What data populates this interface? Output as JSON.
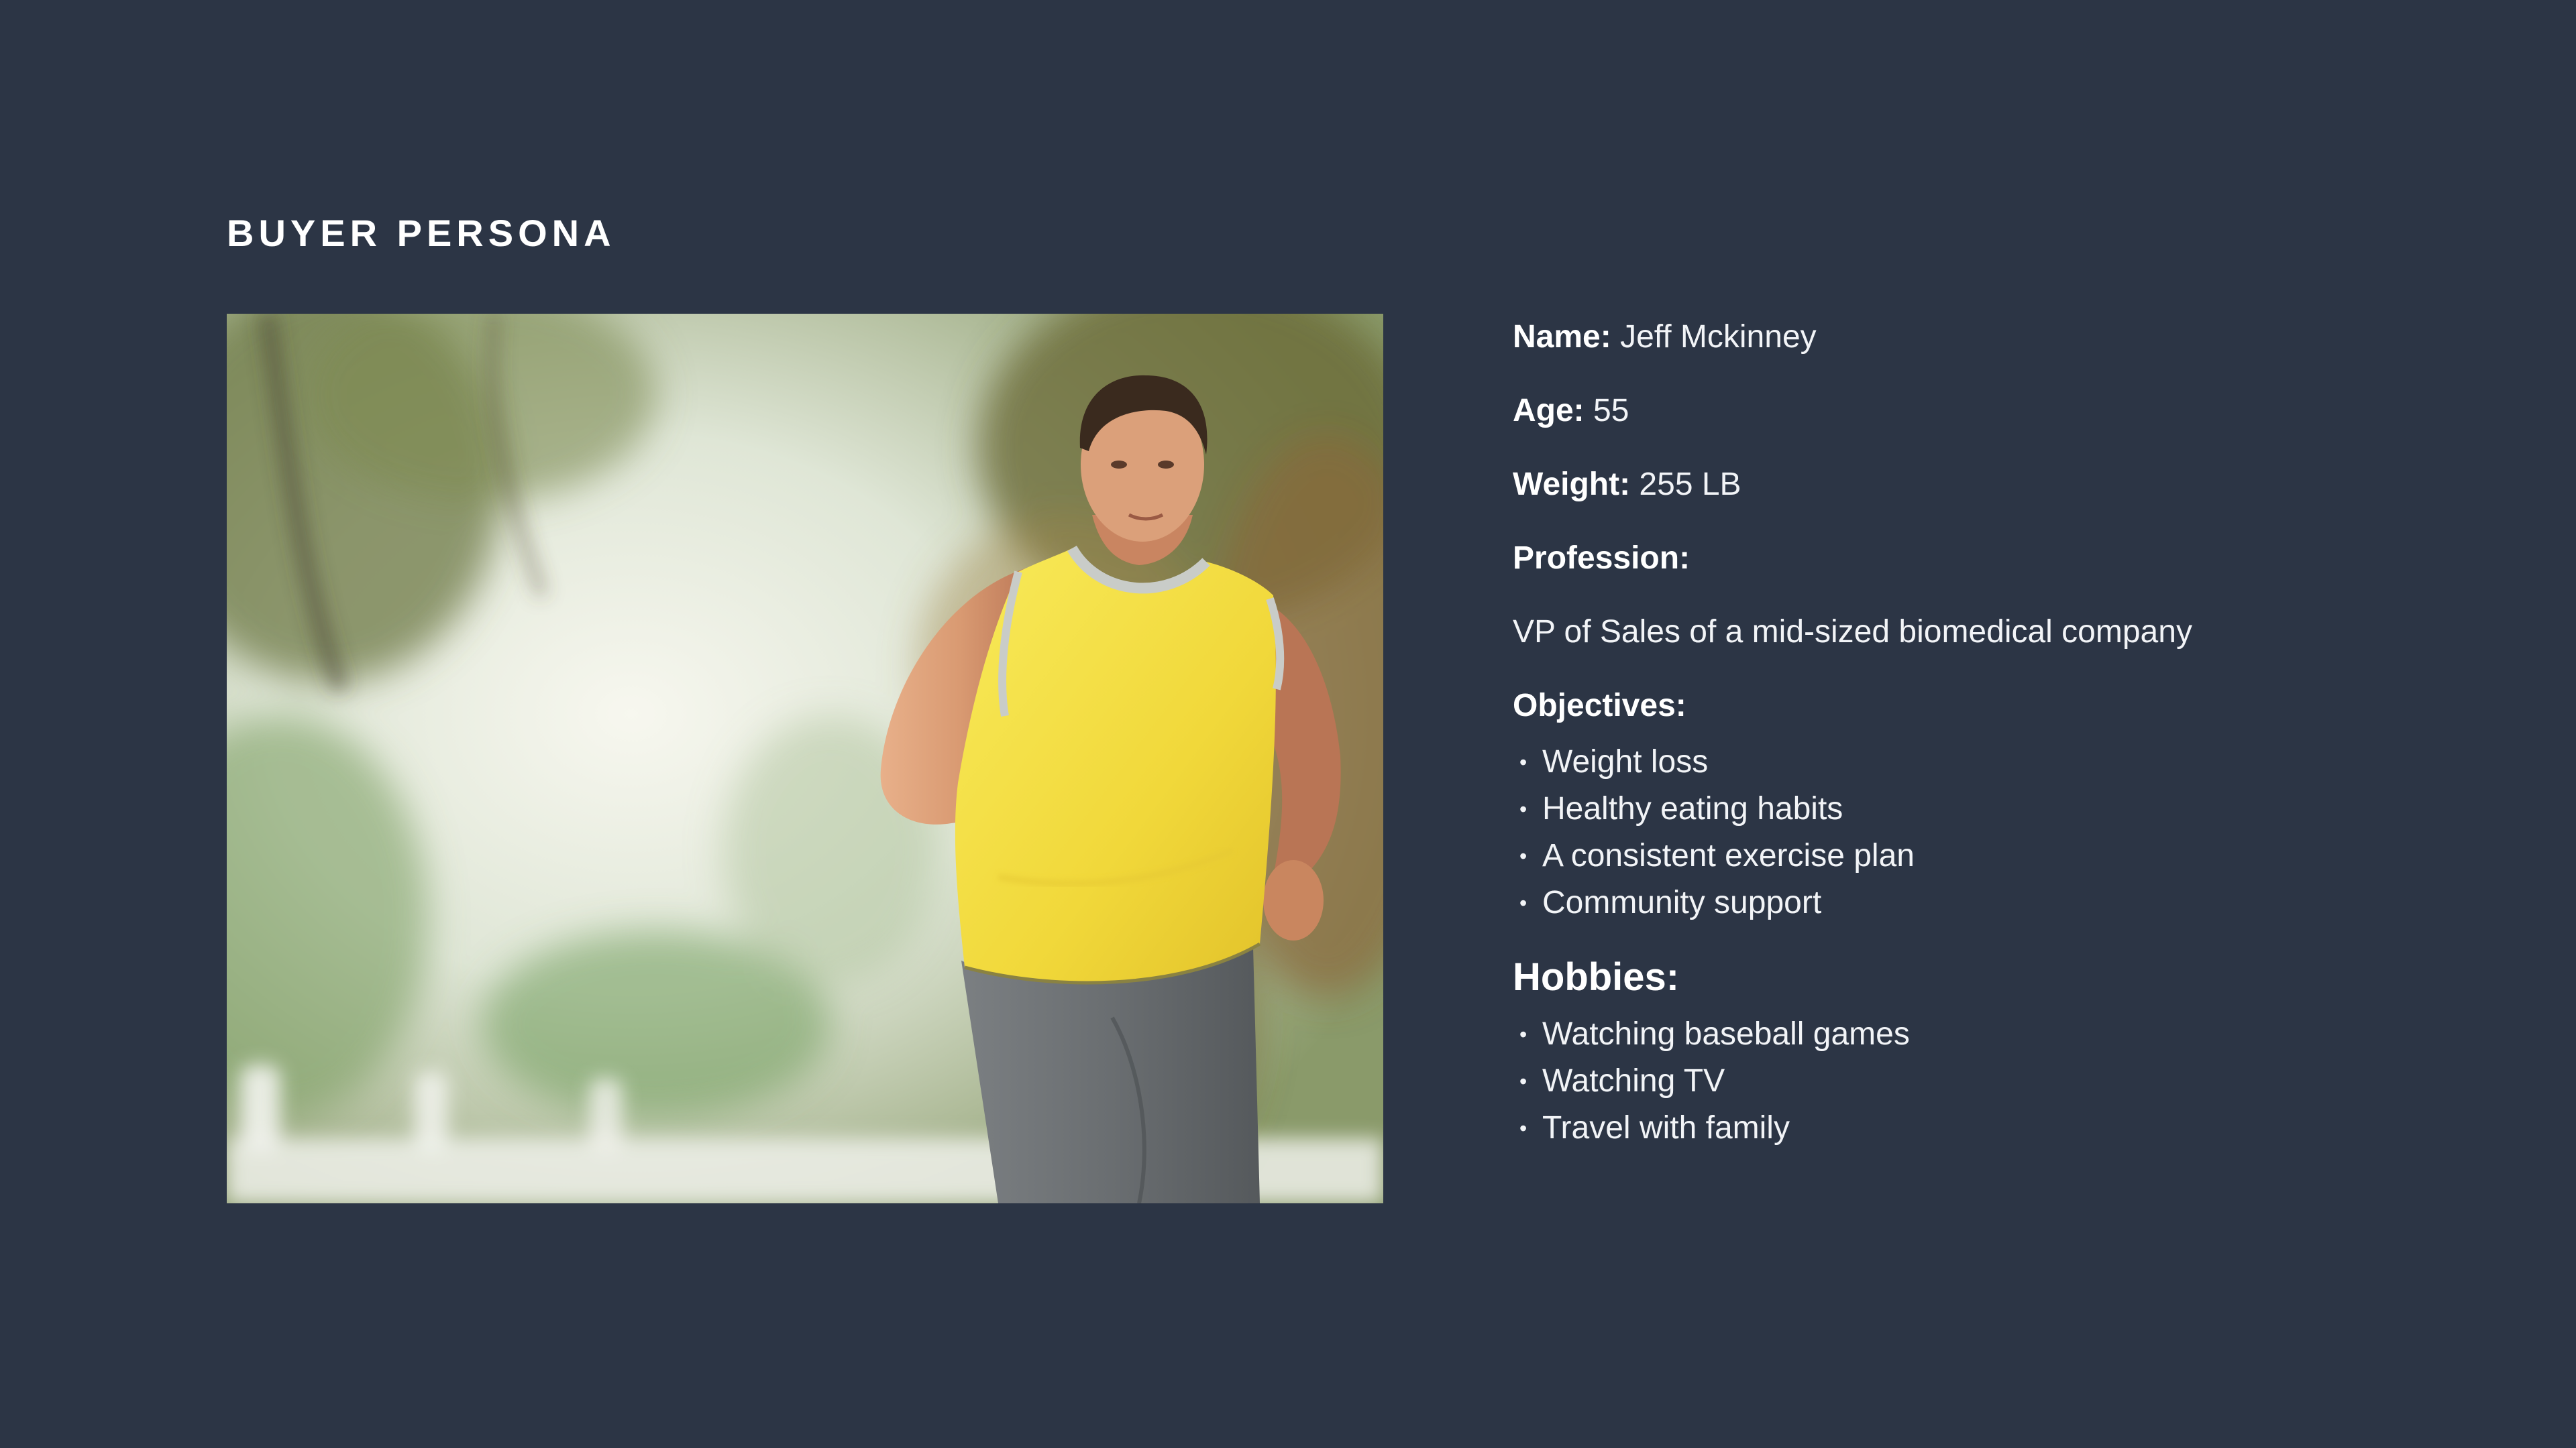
{
  "slide": {
    "title": "BUYER PERSONA"
  },
  "photo": {
    "description_icon": "photo-jogging-man"
  },
  "persona": {
    "name_label": "Name:",
    "name_value": "Jeff Mckinney",
    "age_label": "Age:",
    "age_value": "55",
    "weight_label": "Weight:",
    "weight_value": "255 LB",
    "profession_label": "Profession:",
    "profession_value": "VP of Sales of a mid-sized biomedical company",
    "objectives_label": "Objectives:",
    "objectives": [
      "Weight loss",
      "Healthy eating habits",
      "A consistent exercise plan",
      "Community support"
    ],
    "hobbies_label": "Hobbies:",
    "hobbies": [
      "Watching baseball games",
      "Watching TV",
      "Travel with family"
    ]
  },
  "colors": {
    "background": "#2c3545",
    "text": "#ffffff",
    "shirt": "#f3df3e",
    "shorts": "#6e7275"
  }
}
